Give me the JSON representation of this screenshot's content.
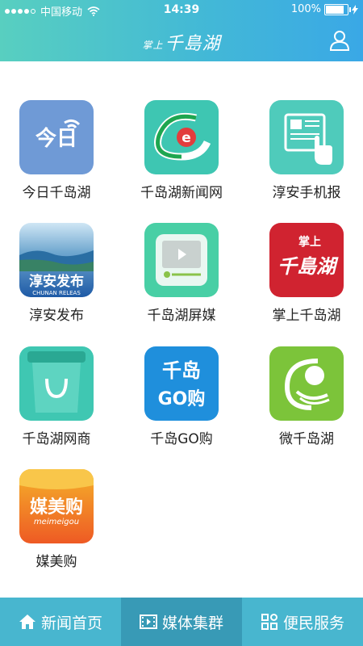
{
  "status": {
    "carrier": "中国移动",
    "time": "14:39",
    "battery": "100%"
  },
  "header": {
    "title_small": "掌上",
    "title": "千島湖"
  },
  "apps": [
    {
      "label": "今日千岛湖",
      "icon": "jinri-icon",
      "text": "今日"
    },
    {
      "label": "千岛湖新闻网",
      "icon": "news-e-icon",
      "text": "e"
    },
    {
      "label": "淳安手机报",
      "icon": "phone-paper-icon",
      "text": ""
    },
    {
      "label": "淳安发布",
      "icon": "chunan-release-icon",
      "text": "淳安发布",
      "sub": "CHUNAN RELEAS"
    },
    {
      "label": "千岛湖屏媒",
      "icon": "video-screen-icon",
      "text": ""
    },
    {
      "label": "掌上千岛湖",
      "icon": "zhangshang-logo-icon",
      "text": "千島湖",
      "sub": "掌上"
    },
    {
      "label": "千岛湖网商",
      "icon": "shopping-bag-icon",
      "text": ""
    },
    {
      "label": "千岛GO购",
      "icon": "go-shop-icon",
      "text": "千岛",
      "sub": "GO购"
    },
    {
      "label": "微千岛湖",
      "icon": "wei-logo-icon",
      "text": ""
    },
    {
      "label": "媒美购",
      "icon": "meimeigou-icon",
      "text": "媒美购",
      "sub": "meimeigou"
    }
  ],
  "tabs": [
    {
      "label": "新闻首页",
      "icon": "home-icon"
    },
    {
      "label": "媒体集群",
      "icon": "film-icon"
    },
    {
      "label": "便民服务",
      "icon": "grid-icon"
    }
  ],
  "colors": {
    "header_start": "#58cfc0",
    "header_end": "#3aa8e6",
    "tabbar": "#48b6cf",
    "tab_active": "#389ab6"
  }
}
